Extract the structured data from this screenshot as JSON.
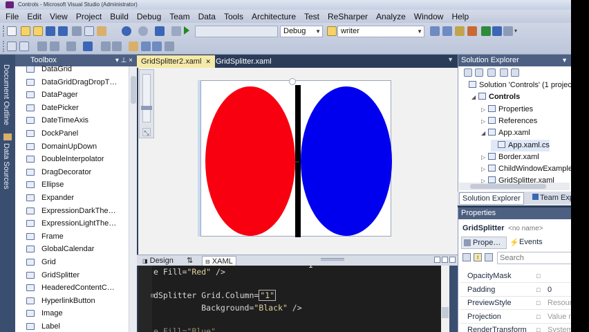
{
  "window": {
    "title": "Controls - Microsoft Visual Studio (Administrator)"
  },
  "menu": [
    "File",
    "Edit",
    "View",
    "Project",
    "Build",
    "Debug",
    "Team",
    "Data",
    "Tools",
    "Architecture",
    "Test",
    "ReSharper",
    "Analyze",
    "Window",
    "Help"
  ],
  "toolbar": {
    "config_value": "Debug",
    "search_value": "writer"
  },
  "left_strip": {
    "document_outline": "Document Outline",
    "data_sources": "Data Sources"
  },
  "toolbox": {
    "title": "Toolbox",
    "pin": "▾ ⊥ ×",
    "items": [
      "DataGrid",
      "DataGridDragDropT…",
      "DataPager",
      "DatePicker",
      "DateTimeAxis",
      "DockPanel",
      "DomainUpDown",
      "DoubleInterpolator",
      "DragDecorator",
      "Ellipse",
      "Expander",
      "ExpressionDarkThe…",
      "ExpressionLightThe…",
      "Frame",
      "GlobalCalendar",
      "Grid",
      "GridSplitter",
      "HeaderedContentC…",
      "HyperlinkButton",
      "Image",
      "Label"
    ],
    "icons": [
      "grid-icon",
      "drag-icon",
      "pager-icon",
      "calendar-icon",
      "axis-icon",
      "dock-icon",
      "updown-icon",
      "interpolator-icon",
      "drag-icon",
      "ellipse-icon",
      "expander-icon",
      "theme-icon",
      "theme-icon",
      "frame-icon",
      "calendar-icon",
      "grid-icon",
      "splitter-icon",
      "content-icon",
      "link-icon",
      "image-icon",
      "label-icon"
    ]
  },
  "tabs": [
    {
      "label": "GridSplitter2.xaml",
      "active": true
    },
    {
      "label": "GridSplitter.xaml",
      "active": false
    }
  ],
  "design_view": {
    "left_ellipse_color": "#f8000f",
    "right_ellipse_color": "#0000ee",
    "splitter_color": "#000000"
  },
  "split_tabs": {
    "design": "Design",
    "swap": "⇅",
    "xaml": "XAML"
  },
  "code_lines": [
    {
      "text_a": "e Fill=",
      "text_b": "\"Red\"",
      "text_c": " />"
    },
    {
      "text_a": "dSplitter Grid.Column=",
      "text_b": "\"1\"",
      "text_c": ""
    },
    {
      "text_a": "          Background=",
      "text_b": "\"Black\"",
      "text_c": " />"
    },
    {
      "text_a": "e Fill=",
      "text_b": "\"Blue\"",
      "text_c": ""
    }
  ],
  "solution_explorer": {
    "title": "Solution Explorer",
    "items": [
      {
        "label": "Solution 'Controls' (1 project)",
        "indent": 0,
        "twisty": ""
      },
      {
        "label": "Controls",
        "indent": 1,
        "twisty": "◢",
        "bold": true
      },
      {
        "label": "Properties",
        "indent": 2,
        "twisty": "▷"
      },
      {
        "label": "References",
        "indent": 2,
        "twisty": "▷"
      },
      {
        "label": "App.xaml",
        "indent": 2,
        "twisty": "◢"
      },
      {
        "label": "App.xaml.cs",
        "indent": 3,
        "twisty": "",
        "selected": true
      },
      {
        "label": "Border.xaml",
        "indent": 2,
        "twisty": "▷"
      },
      {
        "label": "ChildWindowExample.xa",
        "indent": 2,
        "twisty": "▷"
      },
      {
        "label": "GridSplitter.xaml",
        "indent": 2,
        "twisty": "▷"
      }
    ],
    "tab_solution": "Solution Explorer",
    "tab_team": "Team Exp"
  },
  "properties": {
    "title": "Properties",
    "object_name": "GridSplitter",
    "object_hint": "<no name>",
    "tab_properties": "Prope…",
    "tab_events": "Events",
    "search_placeholder": "Search",
    "rows": [
      {
        "name": "OpacityMask",
        "value": "",
        "dim": false
      },
      {
        "name": "Padding",
        "value": "0",
        "dim": false
      },
      {
        "name": "PreviewStyle",
        "value": "Resour",
        "dim": true
      },
      {
        "name": "Projection",
        "value": "Value n",
        "dim": true
      },
      {
        "name": "RenderTransform",
        "value": "System",
        "dim": true
      }
    ]
  }
}
